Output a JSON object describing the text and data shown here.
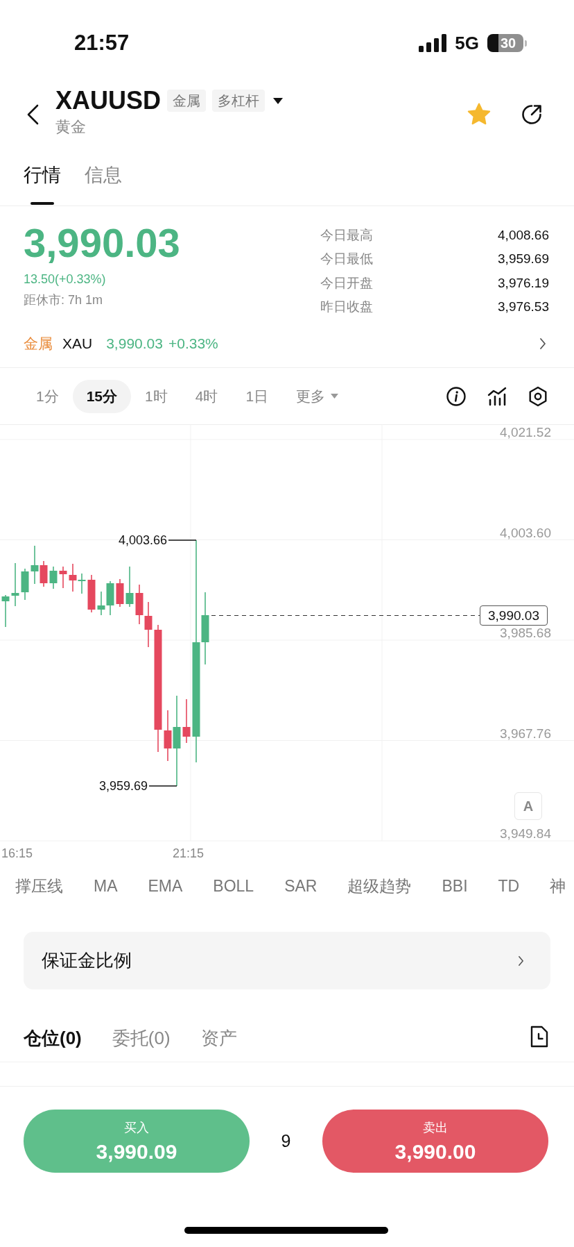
{
  "status_bar": {
    "time": "21:57",
    "network": "5G",
    "battery": "30"
  },
  "header": {
    "symbol": "XAUUSD",
    "tags": [
      "金属",
      "多杠杆"
    ],
    "name": "黄金",
    "favorited": true
  },
  "tabs": [
    {
      "label": "行情",
      "selected": true
    },
    {
      "label": "信息",
      "selected": false
    }
  ],
  "quote": {
    "rising": true,
    "price": "3,990.03",
    "change": "13.50(+0.33%)",
    "countdown": "距休市: 7h 1m",
    "stats": [
      {
        "label": "今日最高",
        "value": "4,008.66"
      },
      {
        "label": "今日最低",
        "value": "3,959.69"
      },
      {
        "label": "今日开盘",
        "value": "3,976.19"
      },
      {
        "label": "昨日收盘",
        "value": "3,976.53"
      }
    ]
  },
  "related": {
    "category": "金属",
    "symbol": "XAU",
    "price": "3,990.03",
    "change": "+0.33%",
    "rising": true
  },
  "timeframes": [
    {
      "label": "1分",
      "selected": false
    },
    {
      "label": "15分",
      "selected": true
    },
    {
      "label": "1时",
      "selected": false
    },
    {
      "label": "4时",
      "selected": false
    },
    {
      "label": "1日",
      "selected": false
    }
  ],
  "more_menu": "更多",
  "chart": {
    "y_axis_labels": [
      "4,021.52",
      "4,003.60",
      "3,985.68",
      "3,967.76",
      "3,949.84"
    ],
    "x_axis_labels": [
      "16:15",
      "21:15"
    ],
    "high_marker": "4,003.66",
    "low_marker": "3,959.69",
    "last_price": "3,990.03",
    "scale_button": "A"
  },
  "indicators": [
    "撑压线",
    "MA",
    "EMA",
    "BOLL",
    "SAR",
    "超级趋势",
    "BBI",
    "TD",
    "神"
  ],
  "margin_row": {
    "label": "保证金比例"
  },
  "position_tabs": [
    {
      "label": "仓位(0)",
      "selected": true
    },
    {
      "label": "委托(0)",
      "selected": false
    },
    {
      "label": "资产",
      "selected": false
    }
  ],
  "trade_bar": {
    "buy": {
      "label": "买入",
      "price": "3,990.09"
    },
    "spread": "9",
    "sell": {
      "label": "卖出",
      "price": "3,990.00"
    }
  }
}
